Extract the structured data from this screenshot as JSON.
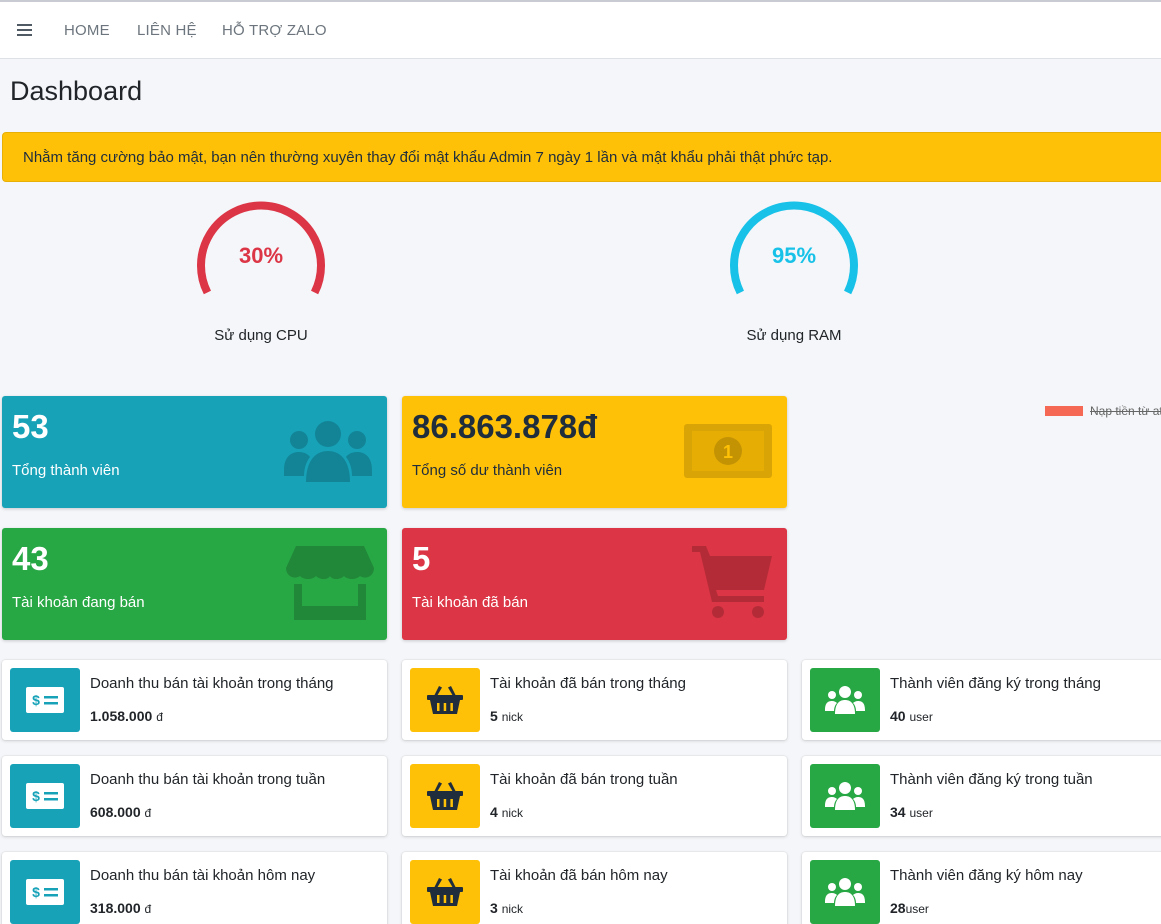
{
  "nav": {
    "menu_icon": "hamburger-icon",
    "links": [
      "HOME",
      "LIÊN HỆ",
      "HỖ TRỢ ZALO"
    ]
  },
  "page_title": "Dashboard",
  "alert_text": "Nhằm tăng cường bảo mật, bạn nên thường xuyên thay đổi mật khẩu Admin 7 ngày 1 lần và mật khẩu phải thật phức tạp.",
  "gauges": {
    "cpu": {
      "value_text": "30%",
      "value": 30,
      "label": "Sử dụng CPU",
      "color": "#dc3545"
    },
    "ram": {
      "value_text": "95%",
      "value": 95,
      "label": "Sử dụng RAM",
      "color": "#17c1e8"
    }
  },
  "legend_text": "Nạp tiền từ atm",
  "stats": {
    "members": {
      "value": "53",
      "label": "Tổng thành viên",
      "icon": "users-icon",
      "color": "#17a2b8"
    },
    "balance": {
      "value": "86.863.878đ",
      "label": "Tổng số dư thành viên",
      "icon": "money-bill-icon",
      "color": "#ffc107"
    },
    "selling": {
      "value": "43",
      "label": "Tài khoản đang bán",
      "icon": "store-icon",
      "color": "#28a745"
    },
    "sold": {
      "value": "5",
      "label": "Tài khoản đã bán",
      "icon": "shopping-cart-icon",
      "color": "#dc3545"
    }
  },
  "info_boxes": {
    "revenue_month": {
      "title": "Doanh thu bán tài khoản trong tháng",
      "number": "1.058.000",
      "unit": "đ",
      "icon": "money-check-icon"
    },
    "sold_month": {
      "title": "Tài khoản đã bán trong tháng",
      "number": "5",
      "unit": "nick",
      "icon": "shopping-basket-icon"
    },
    "members_month": {
      "title": "Thành viên đăng ký trong tháng",
      "number": "40",
      "unit": "user",
      "icon": "users-icon"
    },
    "revenue_week": {
      "title": "Doanh thu bán tài khoản trong tuần",
      "number": "608.000",
      "unit": "đ",
      "icon": "money-check-icon"
    },
    "sold_week": {
      "title": "Tài khoản đã bán trong tuần",
      "number": "4",
      "unit": "nick",
      "icon": "shopping-basket-icon"
    },
    "members_week": {
      "title": "Thành viên đăng ký trong tuần",
      "number": "34",
      "unit": "user",
      "icon": "users-icon"
    },
    "revenue_today": {
      "title": "Doanh thu bán tài khoản hôm nay",
      "number": "318.000",
      "unit": "đ",
      "icon": "money-check-icon"
    },
    "sold_today": {
      "title": "Tài khoản đã bán hôm nay",
      "number": "3",
      "unit": "nick",
      "icon": "shopping-basket-icon"
    },
    "members_today": {
      "title": "Thành viên đăng ký hôm nay",
      "number": "28",
      "unit": "user",
      "icon": "users-icon"
    }
  },
  "colors": {
    "info": "#17a2b8",
    "warning": "#ffc107",
    "success": "#28a745",
    "danger": "#dc3545"
  }
}
